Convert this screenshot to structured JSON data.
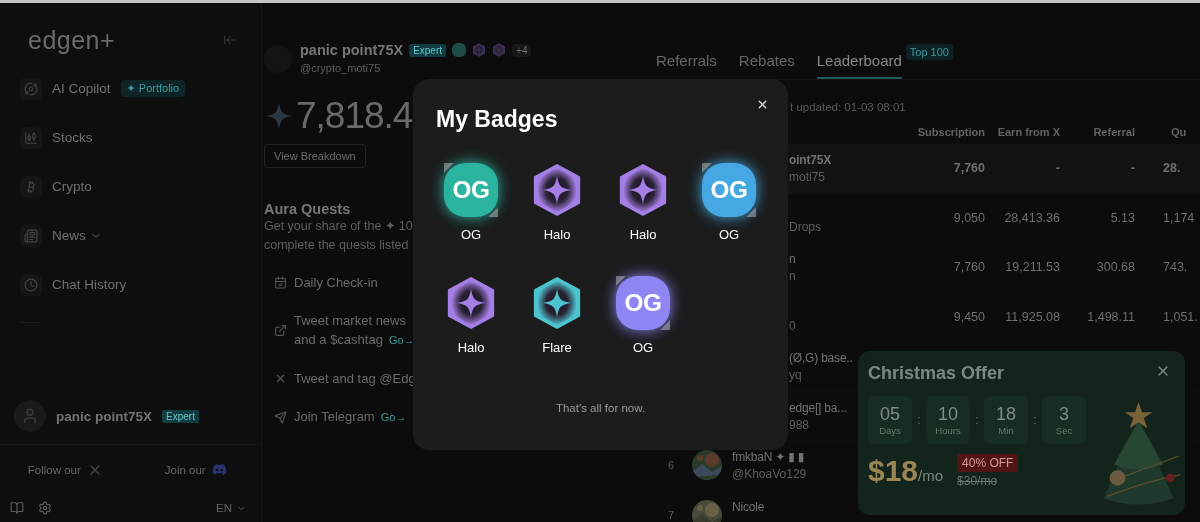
{
  "sidebar": {
    "logo": "edgen+",
    "nav": [
      {
        "kind": "copilot",
        "label": "AI Copilot",
        "badge": "✦ Portfolio"
      },
      {
        "kind": "stocks",
        "label": "Stocks"
      },
      {
        "kind": "crypto",
        "label": "Crypto"
      },
      {
        "kind": "news",
        "label": "News",
        "has_menu": true
      },
      {
        "kind": "history",
        "label": "Chat History"
      }
    ],
    "user": {
      "name": "panic point75X",
      "tier": "Expert"
    },
    "follow": {
      "x_label": "Follow our",
      "discord_label": "Join our"
    },
    "language": "EN"
  },
  "profile": {
    "name": "panic point75X",
    "tier": "Expert",
    "badges": [
      {
        "kind": "og",
        "color": "#1d4d46"
      },
      {
        "kind": "halo",
        "color": "#3e3158"
      },
      {
        "kind": "halo",
        "color": "#3e3158"
      }
    ],
    "more": "+4",
    "handle": "@crypto_moti75",
    "points": "7,818.4",
    "breakdown_button": "View Breakdown"
  },
  "quests": {
    "title": "Aura Quests",
    "description": [
      "Get your share of the ✦ 10",
      "complete the quests listed"
    ],
    "items": [
      {
        "kind": "calendar",
        "lines": [
          "Daily Check-in"
        ]
      },
      {
        "kind": "external",
        "lines": [
          "Tweet market news",
          "and a $cashtag"
        ],
        "link": "Go→"
      },
      {
        "kind": "x",
        "lines": [
          "Tweet and tag @Edg"
        ]
      },
      {
        "kind": "telegram",
        "lines": [
          "Join Telegram"
        ],
        "link": "Go→"
      }
    ]
  },
  "tabs": [
    {
      "label": "Referrals",
      "selected": false
    },
    {
      "label": "Rebates",
      "selected": false
    },
    {
      "label": "Leaderboard",
      "selected": true,
      "tag": "Top 100"
    }
  ],
  "leaderboard": {
    "updated": "t updated: 01-03 08:01",
    "columns": [
      "Subscription",
      "Earn from X",
      "Referral",
      "Qu"
    ],
    "rows": [
      {
        "kind": "partial",
        "highlighted": true,
        "name": "oint75X",
        "handle": "moti75",
        "values": [
          "7,760",
          "-",
          "-",
          "28."
        ]
      },
      {
        "kind": "partial",
        "highlighted": false,
        "handle": "Drops",
        "values": [
          "9,050",
          "28,413.36",
          "5.13",
          "1,174"
        ]
      },
      {
        "kind": "partial",
        "highlighted": false,
        "name": "n",
        "handle": "n",
        "values": [
          "7,760",
          "19,211.53",
          "300.68",
          "743."
        ]
      },
      {
        "kind": "partial",
        "highlighted": false,
        "handle": "0",
        "values": [
          "9,450",
          "11,925.08",
          "1,498.11",
          "1,051."
        ]
      },
      {
        "kind": "partial",
        "highlighted": false,
        "name": "(Ø,G) base..",
        "handle": "yq"
      },
      {
        "kind": "partial",
        "highlighted": false,
        "name": "edge[] ba...",
        "handle": "988"
      },
      {
        "kind": "full",
        "highlighted": false,
        "rank": "6",
        "name": "fmkbaN ✦ ▮ ▮",
        "handle": "@KhoaVo129"
      },
      {
        "kind": "full",
        "highlighted": false,
        "rank": "7",
        "name": "Nicole"
      }
    ]
  },
  "offer": {
    "title": "Christmas Offer",
    "separator": ":",
    "countdown": [
      {
        "value": "05",
        "unit": "Days"
      },
      {
        "value": "10",
        "unit": "Hours"
      },
      {
        "value": "18",
        "unit": "Min"
      },
      {
        "value": "3",
        "unit": "Sec"
      }
    ],
    "price": "$18",
    "period": "/mo",
    "discount": "40% OFF",
    "old_price": "$30/mo"
  },
  "badges_modal": {
    "title": "My Badges",
    "badges": [
      {
        "kind": "og",
        "color": "#2bb5a0",
        "text": "OG",
        "label": "OG"
      },
      {
        "kind": "hex",
        "color": "#a57fe6",
        "label": "Halo"
      },
      {
        "kind": "hex",
        "color": "#a57fe6",
        "label": "Halo"
      },
      {
        "kind": "og",
        "color": "#45a8e2",
        "text": "OG",
        "label": "OG"
      },
      {
        "kind": "hex",
        "color": "#a57fe6",
        "label": "Halo"
      },
      {
        "kind": "hex",
        "color": "#4cc3cf",
        "label": "Flare"
      },
      {
        "kind": "og",
        "color": "#8f86f4",
        "text": "OG",
        "label": "OG"
      }
    ],
    "footer": "That's all for now."
  }
}
